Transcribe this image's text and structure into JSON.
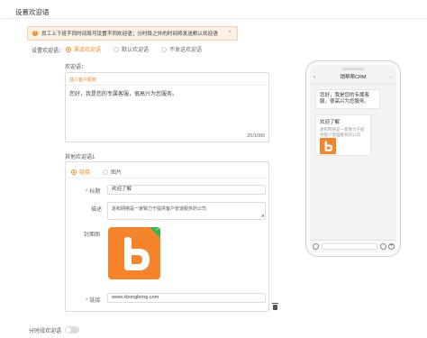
{
  "page": {
    "title": "设置欢迎语"
  },
  "alert": {
    "message": "员工上下班不同时间段可设置不同欢迎语；分时段之外的时间将发送默认欢迎语",
    "close": "×"
  },
  "welcome_type": {
    "label": "设置欢迎语：",
    "options": [
      "渠道欢迎语",
      "默认欢迎语",
      "不发送欢迎语"
    ],
    "selected": "渠道欢迎语"
  },
  "welcome": {
    "label": "欢迎语：",
    "insert_label": "插入客户昵称",
    "text": "您好，我是您的专属客服，很高兴为您服务。",
    "counter": "20/1000"
  },
  "other": {
    "label": "其他欢迎语1",
    "types": [
      "链接",
      "图片"
    ],
    "selected_type": "链接",
    "title_label": "标题",
    "title_value": "欢迎了解",
    "desc_label": "描述",
    "desc_value": "逐和网络是一家致力于提供客户管道服务的公司",
    "cover_label": "封面图",
    "link_label": "链接",
    "link_value": "www.xbongbong.com"
  },
  "timeslot": {
    "label": "分时段欢迎语"
  },
  "preview": {
    "header": "销帮帮CRM",
    "bubble_text": "您好，我是您的专属客服，很高兴为您服务。",
    "card_title": "欢迎了解",
    "card_desc": "逐和网络是一家致力于提\n供客户管理服务的公司"
  },
  "colors": {
    "accent": "#f08a24",
    "cover": "#f5842a",
    "check": "#2fb84f"
  }
}
